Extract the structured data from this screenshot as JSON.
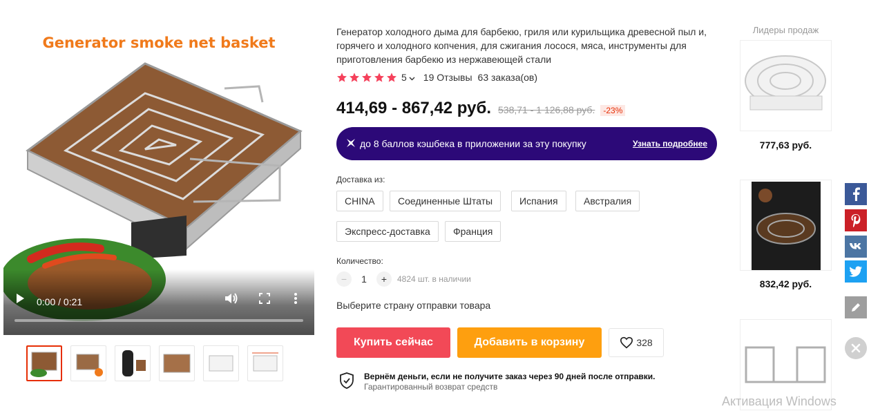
{
  "media": {
    "promo_title": "Generator smoke net basket",
    "time": "0:00 / 0:21",
    "progress": 0,
    "thumbnails": [
      "thumb-1",
      "thumb-2",
      "thumb-3",
      "thumb-4",
      "thumb-5",
      "thumb-6"
    ],
    "active_thumbnail_index": 0
  },
  "product": {
    "title": "Генератор холодного дыма для барбекю, гриля или курильщика древесной пыл и, горячего и холодного копчения, для сжигания лосося, мяса, инструменты для приготовления барбекю из нержавеющей стали",
    "rating": "5",
    "stars": 5,
    "reviews": "19 Отзывы",
    "orders": "63 заказа(ов)",
    "price": "414,69 - 867,42 руб.",
    "old_price": "538,71 - 1 126,88 руб.",
    "discount": "-23%"
  },
  "cashback": {
    "text": "до 8 баллов кэшбека в приложении за эту покупку",
    "link": "Узнать подробнее"
  },
  "shipping": {
    "label": "Доставка из:",
    "options": [
      "CHINA",
      "Соединенные Штаты",
      "Испания",
      "Австралия",
      "Экспресс-доставка",
      "Франция"
    ]
  },
  "quantity": {
    "label": "Количество:",
    "minus": "−",
    "plus": "+",
    "value": "1",
    "stock": "4824 шт. в наличии"
  },
  "country_hint": "Выберите страну отправки товара",
  "actions": {
    "buy_now": "Купить сейчас",
    "add_to_cart": "Добавить в корзину",
    "wishlist_count": "328"
  },
  "guarantee": {
    "title": "Вернём деньги, если не получите заказ через 90 дней после отправки.",
    "subtitle": "Гарантированный возврат средств"
  },
  "bestsellers": {
    "title": "Лидеры продаж",
    "items": [
      {
        "price": "777,63 руб."
      },
      {
        "price": "832,42 руб."
      },
      {
        "price": ""
      }
    ]
  },
  "social": {
    "colors": {
      "facebook": "#3b5998",
      "pinterest": "#cb2027",
      "vk": "#4c75a3",
      "twitter": "#1da1f2",
      "edit": "#9e9e9e"
    }
  },
  "watermark": "Активация Windows",
  "colors": {
    "buy": "#f24957",
    "cart": "#fe9f0f",
    "cashback_bg": "#2c0978",
    "promo_title": "#f07a1b",
    "star": "#f5415b",
    "discount": "#e62e04"
  }
}
